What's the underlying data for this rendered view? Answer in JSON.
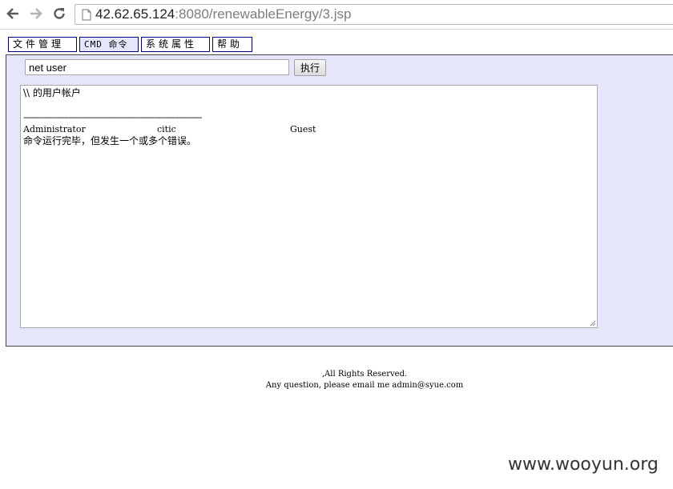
{
  "browser": {
    "url_host": "42.62.65.124",
    "url_rest": ":8080/renewableEnergy/3.jsp",
    "icons": [
      "back-icon",
      "forward-icon",
      "reload-icon",
      "page-icon"
    ]
  },
  "tabs": [
    {
      "label": "文件管理"
    },
    {
      "label": "CMD 命令"
    },
    {
      "label": "系统属性"
    },
    {
      "label": "帮助"
    }
  ],
  "command": {
    "value": "net user",
    "exec_label": "执行"
  },
  "output": {
    "header": "\\\\ 的用户帐户",
    "separator": "-------------------------------------------------------------------------------",
    "users": [
      "Administrator",
      "citic",
      "Guest"
    ],
    "status": "命令运行完毕，但发生一个或多个错误。"
  },
  "footer": {
    "line1": ",All Rights Reserved.",
    "line2": "Any question, please email me admin@syue.com"
  },
  "watermark": "www.wooyun.org",
  "colors": {
    "tab_border": "#00008b",
    "panel_bg": "#e6e6fa"
  }
}
